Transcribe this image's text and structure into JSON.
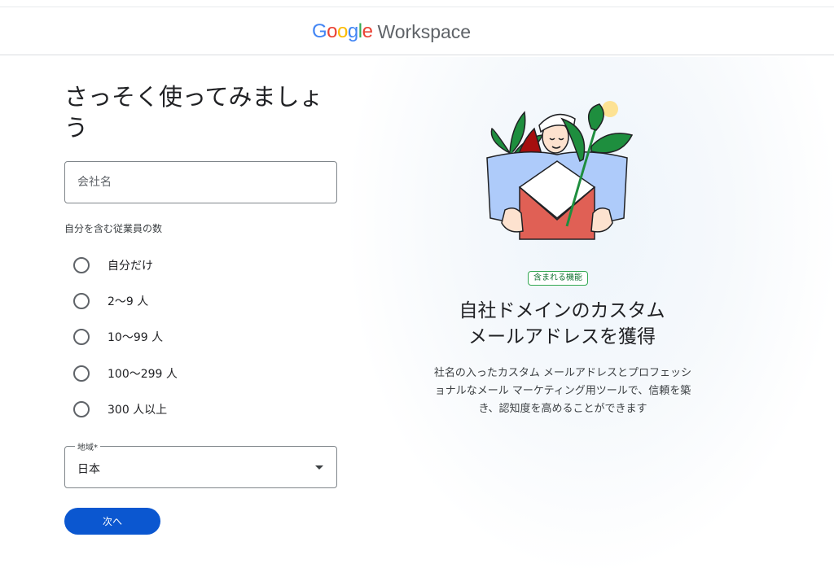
{
  "header": {
    "logo_letters": [
      {
        "char": "G",
        "color": "#4285F4"
      },
      {
        "char": "o",
        "color": "#EA4335"
      },
      {
        "char": "o",
        "color": "#FBBC05"
      },
      {
        "char": "g",
        "color": "#4285F4"
      },
      {
        "char": "l",
        "color": "#34A853"
      },
      {
        "char": "e",
        "color": "#EA4335"
      }
    ],
    "logo_word": "Workspace"
  },
  "form": {
    "title": "さっそく使ってみましょう",
    "company": {
      "placeholder": "会社名",
      "value": ""
    },
    "employees": {
      "label": "自分を含む従業員の数",
      "options": [
        "自分だけ",
        "2〜9 人",
        "10〜99 人",
        "100〜299 人",
        "300 人以上"
      ]
    },
    "region": {
      "label": "地域*",
      "value": "日本"
    },
    "next_label": "次へ"
  },
  "feature": {
    "badge": "含まれる機能",
    "title_line1": "自社ドメインのカスタム",
    "title_line2": "メールアドレスを獲得",
    "description": "社名の入ったカスタム メールアドレスとプロフェッショナルなメール マーケティング用ツールで、信頼を築き、認知度を高めることができます"
  },
  "colors": {
    "primary_button": "#0b57d0",
    "badge_green": "#34a853",
    "envelope_red": "#e06055",
    "plant_green": "#1e8e3e"
  }
}
